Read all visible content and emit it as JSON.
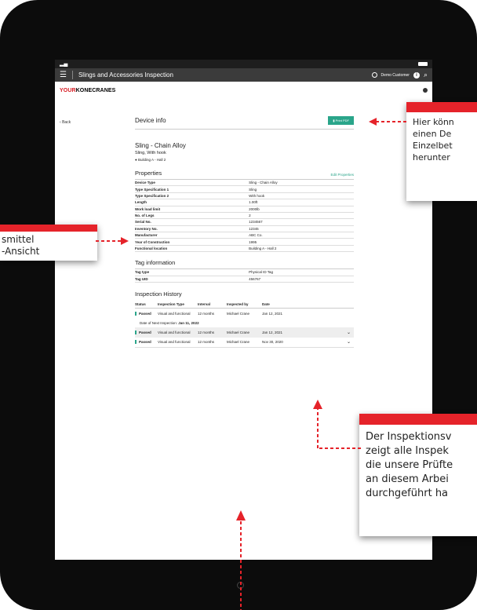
{
  "app": {
    "title": "Slings and Accessories Inspection",
    "customer": "Demo Customer",
    "logo_a": "YOUR",
    "logo_b": "KONECRANES",
    "brand_color": "#d71920",
    "accent_color": "#2aa58a"
  },
  "nav": {
    "back": "Back"
  },
  "device": {
    "heading": "Device info",
    "print_pdf": "Print PDF",
    "name": "Sling - Chain Alloy",
    "subtitle": "Sling, With hook",
    "location": "Building A - Hall 2"
  },
  "properties": {
    "heading": "Properties",
    "edit": "Edit Properties",
    "rows": [
      {
        "k": "Device Type",
        "v": "Sling - Chain Alloy"
      },
      {
        "k": "Type Specification 1",
        "v": "Sling"
      },
      {
        "k": "Type Specification 2",
        "v": "With hook"
      },
      {
        "k": "Length",
        "v": "1.00ft"
      },
      {
        "k": "Work load limit",
        "v": "2000lb"
      },
      {
        "k": "No. of Legs",
        "v": "2"
      },
      {
        "k": "Serial No.",
        "v": "1234567"
      },
      {
        "k": "Inventory No.",
        "v": "12345"
      },
      {
        "k": "Manufacturer",
        "v": "ABC Co."
      },
      {
        "k": "Year of Construction",
        "v": "1995"
      },
      {
        "k": "Functional location",
        "v": "Building A - Hall 2"
      }
    ]
  },
  "tag": {
    "heading": "Tag information",
    "rows": [
      {
        "k": "Tag type",
        "v": "Physical ID Tag"
      },
      {
        "k": "Tag UID",
        "v": "456767"
      }
    ]
  },
  "history": {
    "heading": "Inspection History",
    "columns": [
      "Status",
      "Inspection Type",
      "Interval",
      "Inspected by",
      "Date"
    ],
    "rows": [
      {
        "status": "Passed",
        "type": "Visual and functional",
        "interval": "12 months",
        "by": "Michael Crane",
        "date": "Jan 12, 2021"
      },
      {
        "status": "Passed",
        "type": "Visual and functional",
        "interval": "12 months",
        "by": "Michael Crane",
        "date": "Jan 12, 2021"
      },
      {
        "status": "Passed",
        "type": "Visual and functional",
        "interval": "12 months",
        "by": "Michael Crane",
        "date": "Nov 30, 2020"
      }
    ],
    "next_label": "Date of Next Inspection:",
    "next_date": "Jan 11, 2022"
  },
  "callouts": {
    "c1": [
      "Hier könn",
      "einen De",
      "Einzelbet",
      "herunter"
    ],
    "c2": [
      "smittel",
      "-Ansicht"
    ],
    "c3": [
      "Der Inspektionsv",
      "zeigt alle Inspek",
      "die unsere Prüfte",
      "an diesem Arbei",
      "durchgeführt ha"
    ]
  }
}
